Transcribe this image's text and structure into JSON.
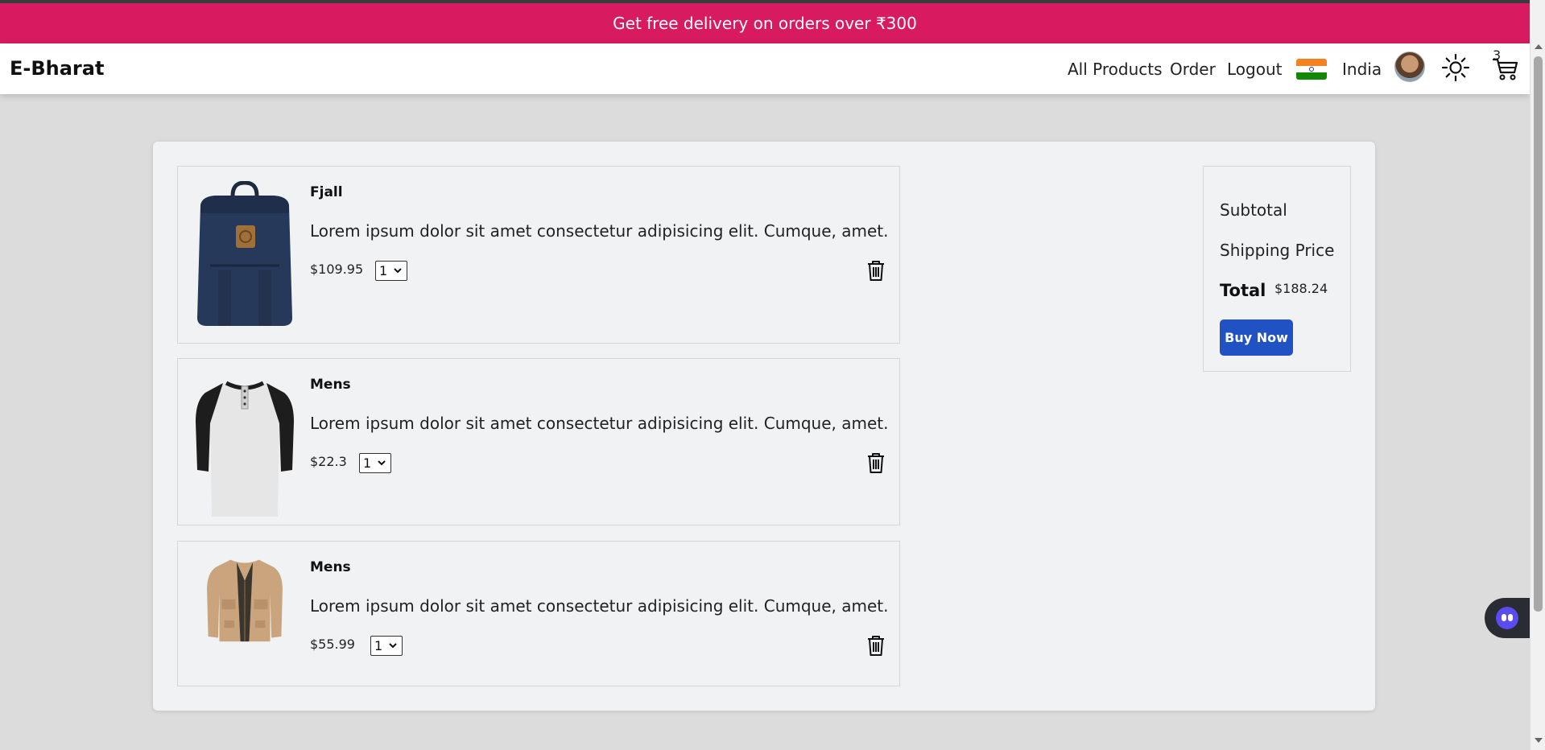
{
  "promo": {
    "text": "Get free delivery on orders over ₹300"
  },
  "header": {
    "brand": "E-Bharat",
    "links": {
      "all_products": "All Products",
      "order": "Order",
      "logout": "Logout"
    },
    "country": "India",
    "cart_count": "3"
  },
  "cart": {
    "items": [
      {
        "title": "Fjall",
        "description": "Lorem ipsum dolor sit amet consectetur adipisicing elit. Cumque, amet.",
        "price": "$109.95",
        "qty": "1",
        "image_icon": "backpack-icon"
      },
      {
        "title": "Mens",
        "description": "Lorem ipsum dolor sit amet consectetur adipisicing elit. Cumque, amet.",
        "price": "$22.3",
        "qty": "1",
        "image_icon": "henley-shirt-icon"
      },
      {
        "title": "Mens",
        "description": "Lorem ipsum dolor sit amet consectetur adipisicing elit. Cumque, amet.",
        "price": "$55.99",
        "qty": "1",
        "image_icon": "jacket-icon"
      }
    ]
  },
  "summary": {
    "subtotal_label": "Subtotal",
    "shipping_label": "Shipping Price",
    "total_label": "Total",
    "total_value": "$188.24",
    "buy_label": "Buy Now"
  },
  "colors": {
    "promo_bg": "#d81b60",
    "buy_button": "#2152c4"
  }
}
